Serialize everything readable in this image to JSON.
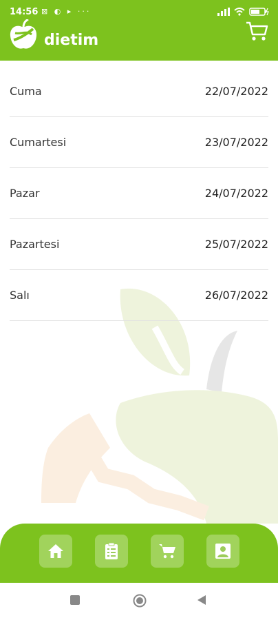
{
  "status": {
    "time": "14:56",
    "left_icons": "⊠ ◐ ▸  ···",
    "battery_icon": "battery-charging-icon"
  },
  "app": {
    "title": "dietim",
    "cart_icon": "cart-icon",
    "logo_icon": "apple-logo-icon"
  },
  "days": [
    {
      "day": "Cuma",
      "date": "22/07/2022"
    },
    {
      "day": "Cumartesi",
      "date": "23/07/2022"
    },
    {
      "day": "Pazar",
      "date": "24/07/2022"
    },
    {
      "day": "Pazartesi",
      "date": "25/07/2022"
    },
    {
      "day": "Salı",
      "date": "26/07/2022"
    }
  ],
  "bottom_nav": [
    {
      "icon": "home-icon"
    },
    {
      "icon": "clipboard-list-icon"
    },
    {
      "icon": "cart-icon"
    },
    {
      "icon": "user-icon"
    }
  ],
  "colors": {
    "primary": "#7dc21e",
    "text": "#333333",
    "divider": "#e2e2e2"
  }
}
